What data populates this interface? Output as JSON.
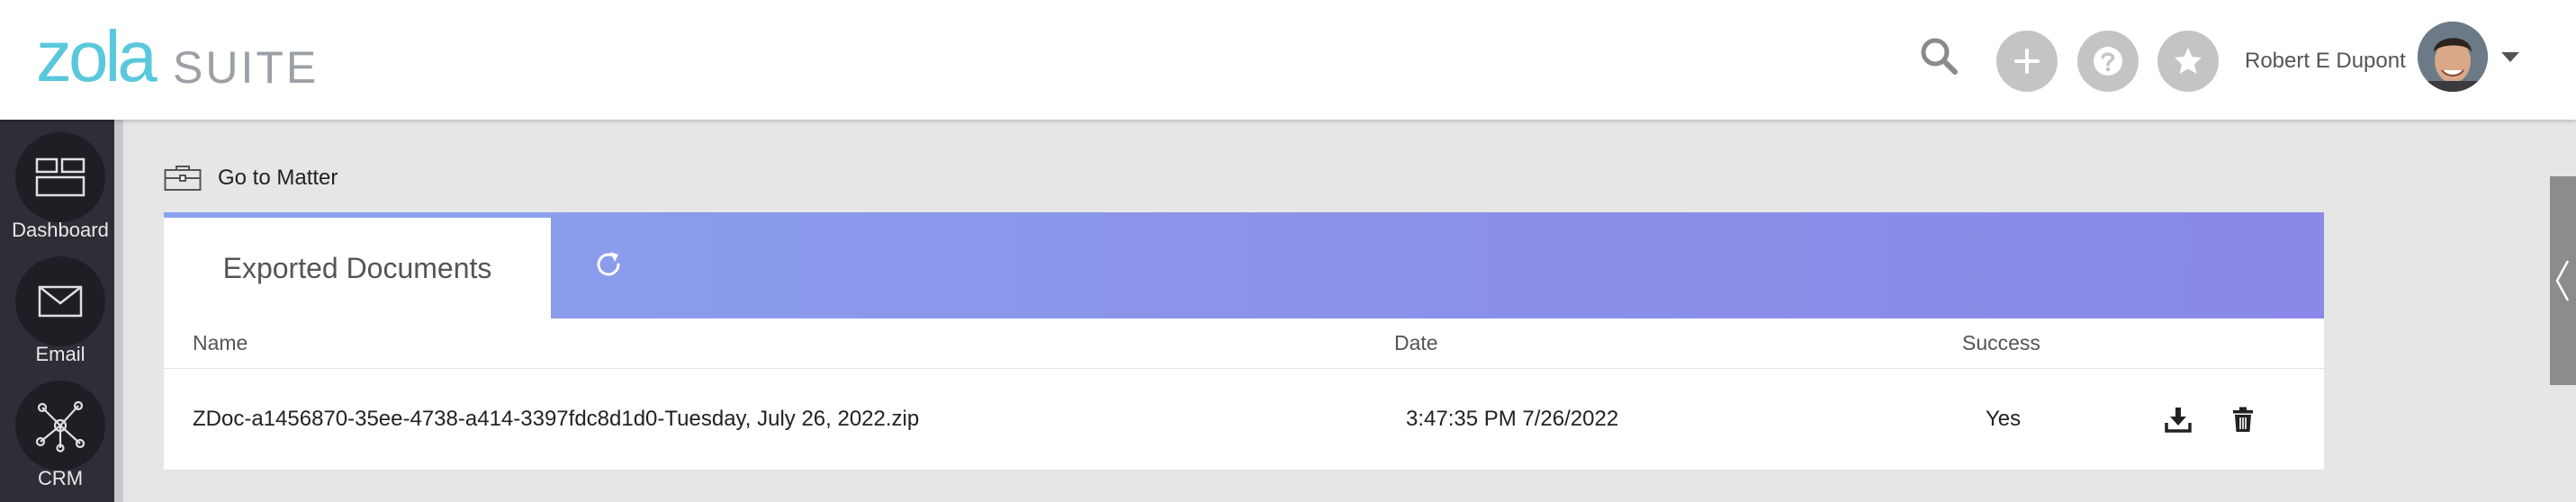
{
  "brand": {
    "logo_primary": "zola",
    "logo_secondary": "SUITE",
    "accent": "#5ac8dc"
  },
  "header": {
    "icons": [
      "search-icon",
      "plus-icon",
      "question-icon",
      "star-icon"
    ],
    "user_name": "Robert E Dupont"
  },
  "sidebar": {
    "items": [
      {
        "label": "Dashboard",
        "icon": "dashboard-icon"
      },
      {
        "label": "Email",
        "icon": "envelope-icon"
      },
      {
        "label": "CRM",
        "icon": "network-icon"
      }
    ]
  },
  "main": {
    "goto_label": "Go to Matter",
    "tab_label": "Exported Documents",
    "tabbar_color": "#8a98ea",
    "table": {
      "columns": [
        "Name",
        "Date",
        "Success"
      ],
      "rows": [
        {
          "name": "ZDoc-a1456870-35ee-4738-a414-3397fdc8d1d0-Tuesday, July 26, 2022.zip",
          "date": "3:47:35 PM 7/26/2022",
          "success": "Yes"
        }
      ]
    }
  }
}
